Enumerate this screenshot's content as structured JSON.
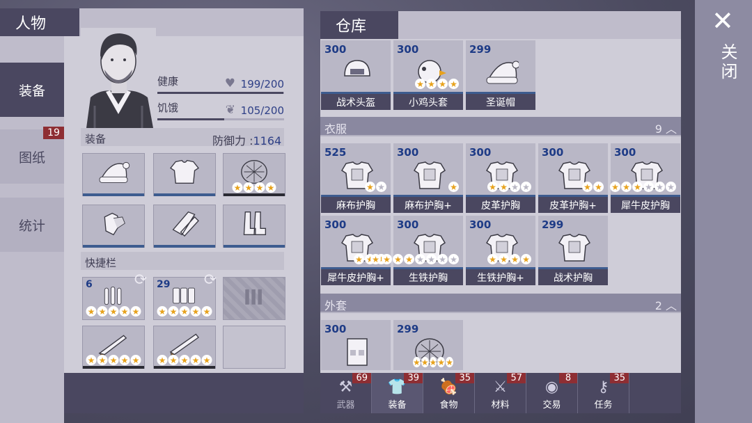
{
  "character": {
    "title": "人物",
    "tabs": [
      {
        "label": "装备",
        "count": ""
      },
      {
        "label": "图纸",
        "count": "19"
      },
      {
        "label": "统计",
        "count": ""
      }
    ],
    "health_label": "健康",
    "health_value": "199/200",
    "health_fraction": 0.995,
    "hunger_label": "饥饿",
    "hunger_value": "105/200",
    "hunger_fraction": 0.525,
    "equipment_label": "装备",
    "defense_label": "防御力 :",
    "defense_value": "1164",
    "quickbar_label": "快捷栏",
    "equipment_slots": [
      {
        "icon": "santa-hat-icon",
        "stars": 0
      },
      {
        "icon": "chest-armor-icon",
        "stars": 0
      },
      {
        "icon": "turtle-shell-icon",
        "stars": 4
      },
      {
        "icon": "gloves-icon",
        "stars": 0
      },
      {
        "icon": "pants-icon",
        "stars": 0
      },
      {
        "icon": "boots-icon",
        "stars": 0
      }
    ],
    "quick_slots": [
      {
        "icon": "bullets-icon",
        "qty": "6",
        "stars": 5
      },
      {
        "icon": "shells-icon",
        "qty": "29",
        "stars": 5
      },
      {
        "icon": "locked-slot-icon",
        "qty": "",
        "stars": 0
      },
      {
        "icon": "shotgun-icon",
        "qty": "",
        "stars": 5
      },
      {
        "icon": "double-barrel-shotgun-icon",
        "qty": "",
        "stars": 5
      },
      {
        "icon": "empty-slot",
        "qty": "",
        "stars": 0
      }
    ]
  },
  "warehouse": {
    "title": "仓库",
    "helmets": [
      {
        "qty": "300",
        "name": "战术头盔",
        "icon": "tactical-helmet-icon",
        "stars": 0
      },
      {
        "qty": "300",
        "name": "小鸡头套",
        "icon": "chicken-mask-icon",
        "stars": 4
      },
      {
        "qty": "299",
        "name": "圣诞帽",
        "icon": "santa-hat-icon",
        "stars": 0
      }
    ],
    "clothes_category": {
      "name": "衣服",
      "count": "9"
    },
    "clothes": [
      {
        "qty": "525",
        "name": "麻布护胸",
        "icon": "linen-chest-icon",
        "stars": 1,
        "gray": 1
      },
      {
        "qty": "300",
        "name": "麻布护胸+",
        "icon": "linen-chest-plus-icon",
        "stars": 1,
        "gray": 0
      },
      {
        "qty": "300",
        "name": "皮革护胸",
        "icon": "leather-chest-icon",
        "stars": 2,
        "gray": 2
      },
      {
        "qty": "300",
        "name": "皮革护胸+",
        "icon": "leather-chest-plus-icon",
        "stars": 2,
        "gray": 0
      },
      {
        "qty": "300",
        "name": "犀牛皮护胸",
        "icon": "rhino-chest-icon",
        "stars": 3,
        "gray": 3
      },
      {
        "qty": "300",
        "name": "犀牛皮护胸+",
        "icon": "rhino-chest-plus-icon",
        "stars": 3,
        "gray": 0
      },
      {
        "qty": "300",
        "name": "生铁护胸",
        "icon": "iron-chest-icon",
        "stars": 4,
        "gray": 4
      },
      {
        "qty": "300",
        "name": "生铁护胸+",
        "icon": "iron-chest-plus-icon",
        "stars": 4,
        "gray": 0
      },
      {
        "qty": "299",
        "name": "战术护胸",
        "icon": "tactical-chest-icon",
        "stars": 0,
        "gray": 0
      }
    ],
    "coat_category": {
      "name": "外套",
      "count": "2"
    },
    "coats": [
      {
        "qty": "300",
        "icon": "tactical-vest-icon",
        "stars": 0
      },
      {
        "qty": "299",
        "icon": "turtle-shell-icon",
        "stars": 5
      }
    ],
    "bottom_tabs": [
      {
        "label": "武器",
        "count": "69",
        "icon": "axe-icon"
      },
      {
        "label": "装备",
        "count": "39",
        "icon": "shirt-icon"
      },
      {
        "label": "食物",
        "count": "35",
        "icon": "meat-icon"
      },
      {
        "label": "材料",
        "count": "57",
        "icon": "wood-icon"
      },
      {
        "label": "交易",
        "count": "8",
        "icon": "coin-icon"
      },
      {
        "label": "任务",
        "count": "35",
        "icon": "key-icon"
      }
    ]
  },
  "close": {
    "label": "关闭",
    "icon": "close-icon"
  }
}
